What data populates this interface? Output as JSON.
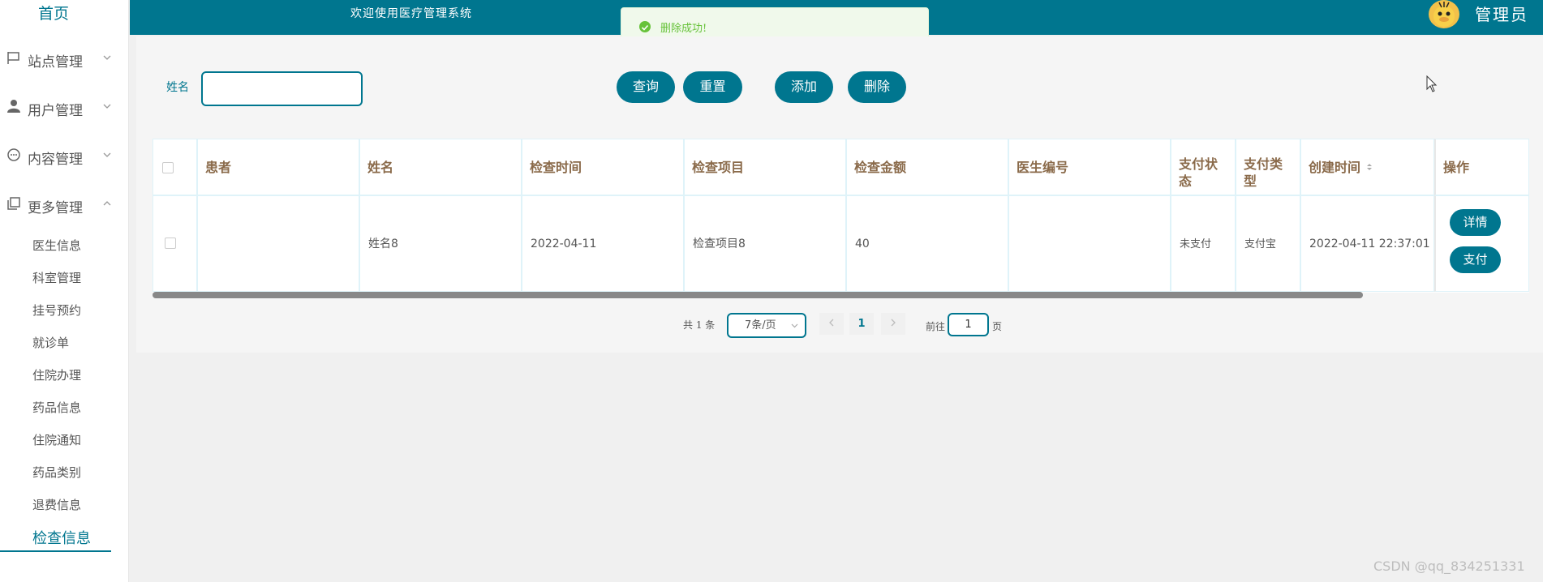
{
  "app": {
    "home_label": "首页",
    "welcome": "欢迎使用医疗管理系统",
    "user_role": "管理员",
    "accent_color": "#00768f"
  },
  "toast": {
    "message": "删除成功!",
    "icon": "check-circle-icon",
    "color": "#67c23a"
  },
  "sidebar": {
    "menus": [
      {
        "label": "站点管理",
        "icon": "flag-icon",
        "expanded": false
      },
      {
        "label": "用户管理",
        "icon": "user-icon",
        "expanded": false
      },
      {
        "label": "内容管理",
        "icon": "chat-icon",
        "expanded": false
      },
      {
        "label": "更多管理",
        "icon": "copy-icon",
        "expanded": true
      }
    ],
    "sub_items": [
      "医生信息",
      "科室管理",
      "挂号预约",
      "就诊单",
      "住院办理",
      "药品信息",
      "住院通知",
      "药品类别",
      "退费信息",
      "检查信息"
    ],
    "active_item": "检查信息"
  },
  "search": {
    "label": "姓名",
    "value": "",
    "buttons": {
      "query": "查询",
      "reset": "重置",
      "add": "添加",
      "delete": "删除"
    }
  },
  "table": {
    "columns": [
      "患者",
      "姓名",
      "检查时间",
      "检查项目",
      "检查金额",
      "医生编号",
      "支付状态",
      "支付类型",
      "创建时间",
      "操作"
    ],
    "sortable_column": "创建时间",
    "rows": [
      {
        "patient": "",
        "name": "姓名8",
        "check_time": "2022-04-11",
        "check_item": "检查项目8",
        "amount": "40",
        "doctor_no": "",
        "pay_status": "未支付",
        "pay_type": "支付宝",
        "created_at": "2022-04-11 22:37:01",
        "actions": [
          "详情",
          "支付"
        ]
      }
    ]
  },
  "pagination": {
    "total_text": "共 1 条",
    "page_size": "7条/页",
    "current_page": "1",
    "goto_label": "前往",
    "goto_value": "1",
    "goto_suffix": "页"
  },
  "watermark": "CSDN @qq_834251331"
}
